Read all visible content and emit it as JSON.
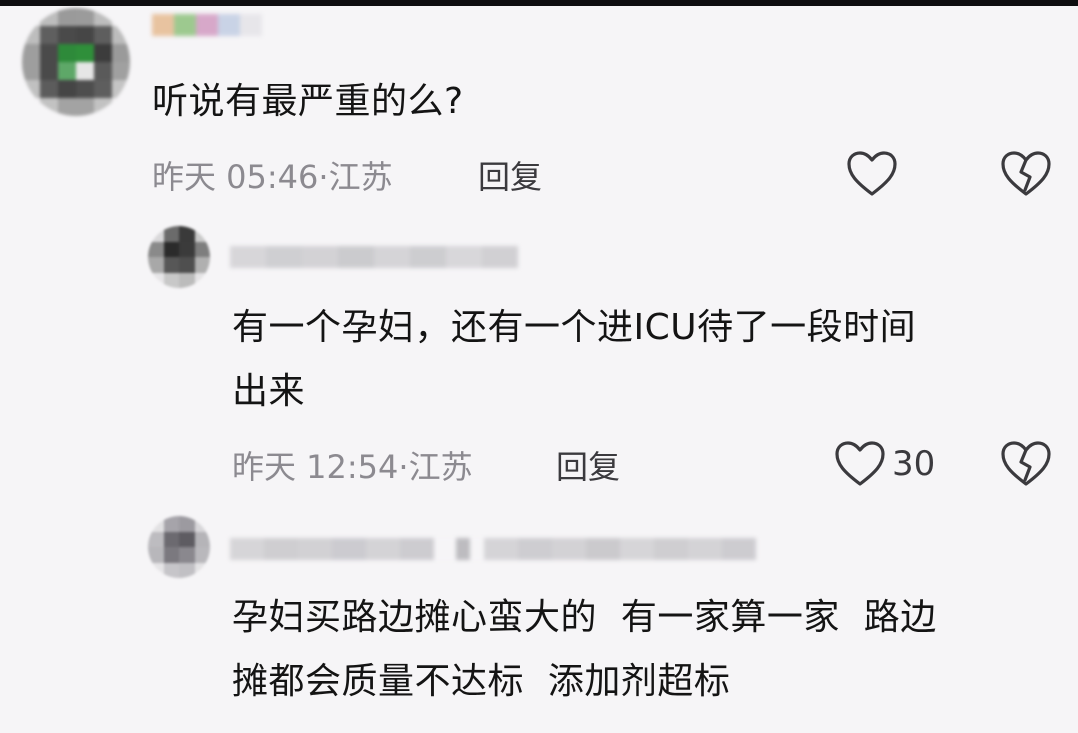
{
  "comments": [
    {
      "text": "听说有最严重的么?",
      "time": "昨天 05:46·",
      "location": "江苏",
      "reply_label": "回复",
      "like_count": ""
    },
    {
      "text": "有一个孕妇，还有一个进ICU待了一段时间\n出来",
      "time": "昨天 12:54·",
      "location": "江苏",
      "reply_label": "回复",
      "like_count": "30"
    },
    {
      "text": "孕妇买路边摊心蛮大的  有一家算一家  路边\n摊都会质量不达标  添加剂超标",
      "time": "",
      "location": "",
      "reply_label": "",
      "like_count": ""
    }
  ],
  "icons": {
    "like": "heart-outline-icon",
    "dislike": "broken-heart-icon"
  },
  "colors": {
    "background": "#f6f5f7",
    "meta_text": "#8c8a90",
    "primary_text": "#141414"
  }
}
